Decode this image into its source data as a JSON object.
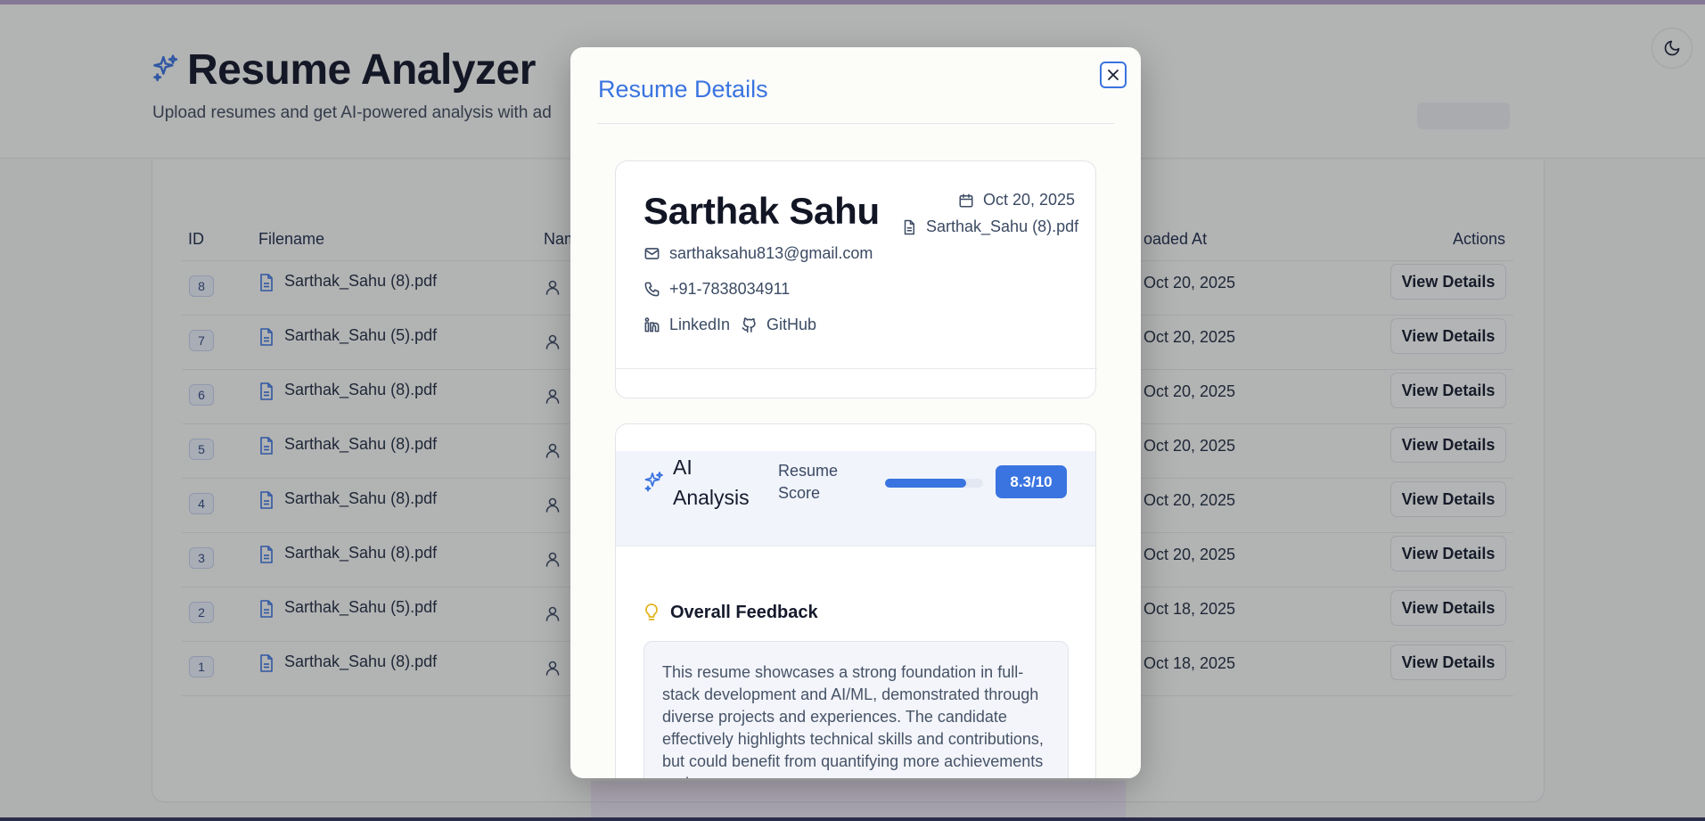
{
  "app": {
    "title": "Resume Analyzer",
    "subtitle": "Upload resumes and get AI-powered analysis with ad"
  },
  "table": {
    "headers": {
      "id": "ID",
      "filename": "Filename",
      "name": "Nam",
      "uploaded_at": "oaded At",
      "actions": "Actions"
    },
    "rows": [
      {
        "id": "8",
        "filename": "Sarthak_Sahu (8).pdf",
        "uploaded_at": "Oct 20, 2025",
        "action": "View Details"
      },
      {
        "id": "7",
        "filename": "Sarthak_Sahu (5).pdf",
        "uploaded_at": "Oct 20, 2025",
        "action": "View Details"
      },
      {
        "id": "6",
        "filename": "Sarthak_Sahu (8).pdf",
        "uploaded_at": "Oct 20, 2025",
        "action": "View Details"
      },
      {
        "id": "5",
        "filename": "Sarthak_Sahu (8).pdf",
        "uploaded_at": "Oct 20, 2025",
        "action": "View Details"
      },
      {
        "id": "4",
        "filename": "Sarthak_Sahu (8).pdf",
        "uploaded_at": "Oct 20, 2025",
        "action": "View Details"
      },
      {
        "id": "3",
        "filename": "Sarthak_Sahu (8).pdf",
        "uploaded_at": "Oct 20, 2025",
        "action": "View Details"
      },
      {
        "id": "2",
        "filename": "Sarthak_Sahu (5).pdf",
        "uploaded_at": "Oct 18, 2025",
        "action": "View Details"
      },
      {
        "id": "1",
        "filename": "Sarthak_Sahu (8).pdf",
        "uploaded_at": "Oct 18, 2025",
        "action": "View Details"
      }
    ]
  },
  "modal": {
    "title": "Resume Details",
    "candidate": {
      "name": "Sarthak Sahu",
      "email": "sarthaksahu813@gmail.com",
      "phone": "+91-7838034911",
      "linkedin": "LinkedIn",
      "github": "GitHub",
      "date": "Oct 20, 2025",
      "file": "Sarthak_Sahu (8).pdf"
    },
    "analysis": {
      "title": "AI Analysis",
      "score_label": "Resume Score",
      "score": 8.3,
      "score_text": "8.3/10",
      "feedback_title": "Overall Feedback",
      "feedback_text": "This resume showcases a strong foundation in full-stack development and AI/ML, demonstrated through diverse projects and experiences. The candidate effectively highlights technical skills and contributions, but could benefit from quantifying more achievements and"
    }
  },
  "colors": {
    "accent": "#3a74e0",
    "feedback_icon": "#e3b21a",
    "overlay": "rgba(30, 33, 40, 0.33)"
  },
  "icons": {
    "logo": "sparkles-icon",
    "theme": "moon-icon",
    "row_file": "file-icon",
    "row_user": "user-icon",
    "close": "close-icon",
    "date": "calendar-icon",
    "file": "file-icon",
    "email": "mail-icon",
    "phone": "phone-icon",
    "linkedin": "linkedin-icon",
    "github": "github-icon",
    "ai": "sparkles-icon",
    "feedback": "lightbulb-icon"
  }
}
